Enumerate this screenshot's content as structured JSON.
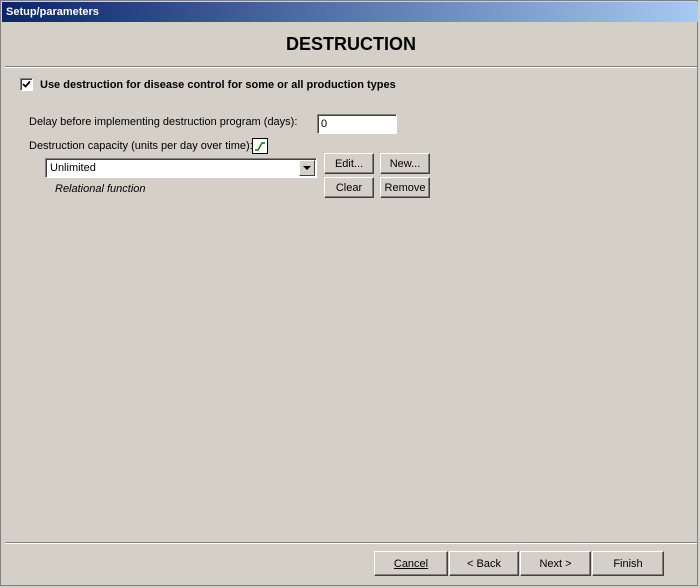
{
  "window": {
    "title": "Setup/parameters"
  },
  "header": {
    "title": "DESTRUCTION"
  },
  "use_destruction": {
    "checked": true,
    "label": "Use destruction for disease control for some or all production types"
  },
  "delay": {
    "label": "Delay before implementing destruction program (days):",
    "value": "0"
  },
  "capacity": {
    "label": "Destruction capacity (units per day over time):",
    "graph_icon": "graph-icon",
    "selected": "Unlimited",
    "subtitle": "Relational function"
  },
  "function_buttons": {
    "edit": "Edit...",
    "new": "New...",
    "clear": "Clear",
    "remove": "Remove"
  },
  "footer": {
    "cancel": "Cancel",
    "back": "< Back",
    "next": "Next >",
    "finish": "Finish"
  },
  "colors": {
    "background": "#d4d0c8",
    "titlebar_start": "#0a246a",
    "titlebar_end": "#a6caf0",
    "graph_line": "#008000"
  }
}
